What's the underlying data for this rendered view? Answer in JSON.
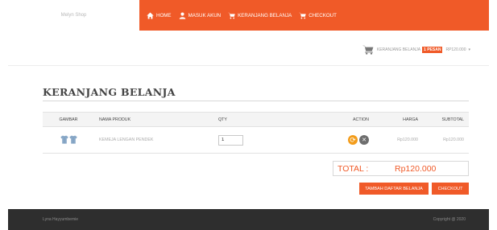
{
  "brand": {
    "name": "Melyn Shop"
  },
  "nav": {
    "items": [
      {
        "label": "HOME",
        "icon": "home-icon"
      },
      {
        "label": "MASUK AKUN",
        "icon": "user-icon"
      },
      {
        "label": "KERANJANG BELANJA",
        "icon": "cart-icon"
      },
      {
        "label": "CHECKOUT",
        "icon": "cart-icon"
      }
    ]
  },
  "cart_widget": {
    "label": "KERANJANG BELANJA",
    "badge": "1 PESAN",
    "total": "RP120.000",
    "caret": "▾"
  },
  "page": {
    "title": "KERANJANG BELANJA"
  },
  "table": {
    "headers": {
      "image": "GAMBAR",
      "name": "NAMA PRODUK",
      "qty": "QTY",
      "action": "ACTION",
      "price": "HARGA",
      "subtotal": "SUBTOTAL"
    },
    "rows": [
      {
        "name": "KEMEJA LENGAN PENDEK",
        "qty": "1",
        "price": "Rp120.000",
        "subtotal": "Rp120.000"
      }
    ]
  },
  "total": {
    "label": "TOTAL :",
    "value": "Rp120.000"
  },
  "buttons": {
    "continue": "TAMBAH DAFTAR BELANJA",
    "checkout": "CHECKOUT"
  },
  "footer": {
    "left": "Lyna Hayyumbemie",
    "right": "Copyright @ 2020"
  },
  "colors": {
    "accent": "#f05a28",
    "footer_bg": "#2e2e2e",
    "update": "#f39c1a",
    "remove": "#6e6e6e",
    "shirt": "#8aa9c8"
  }
}
